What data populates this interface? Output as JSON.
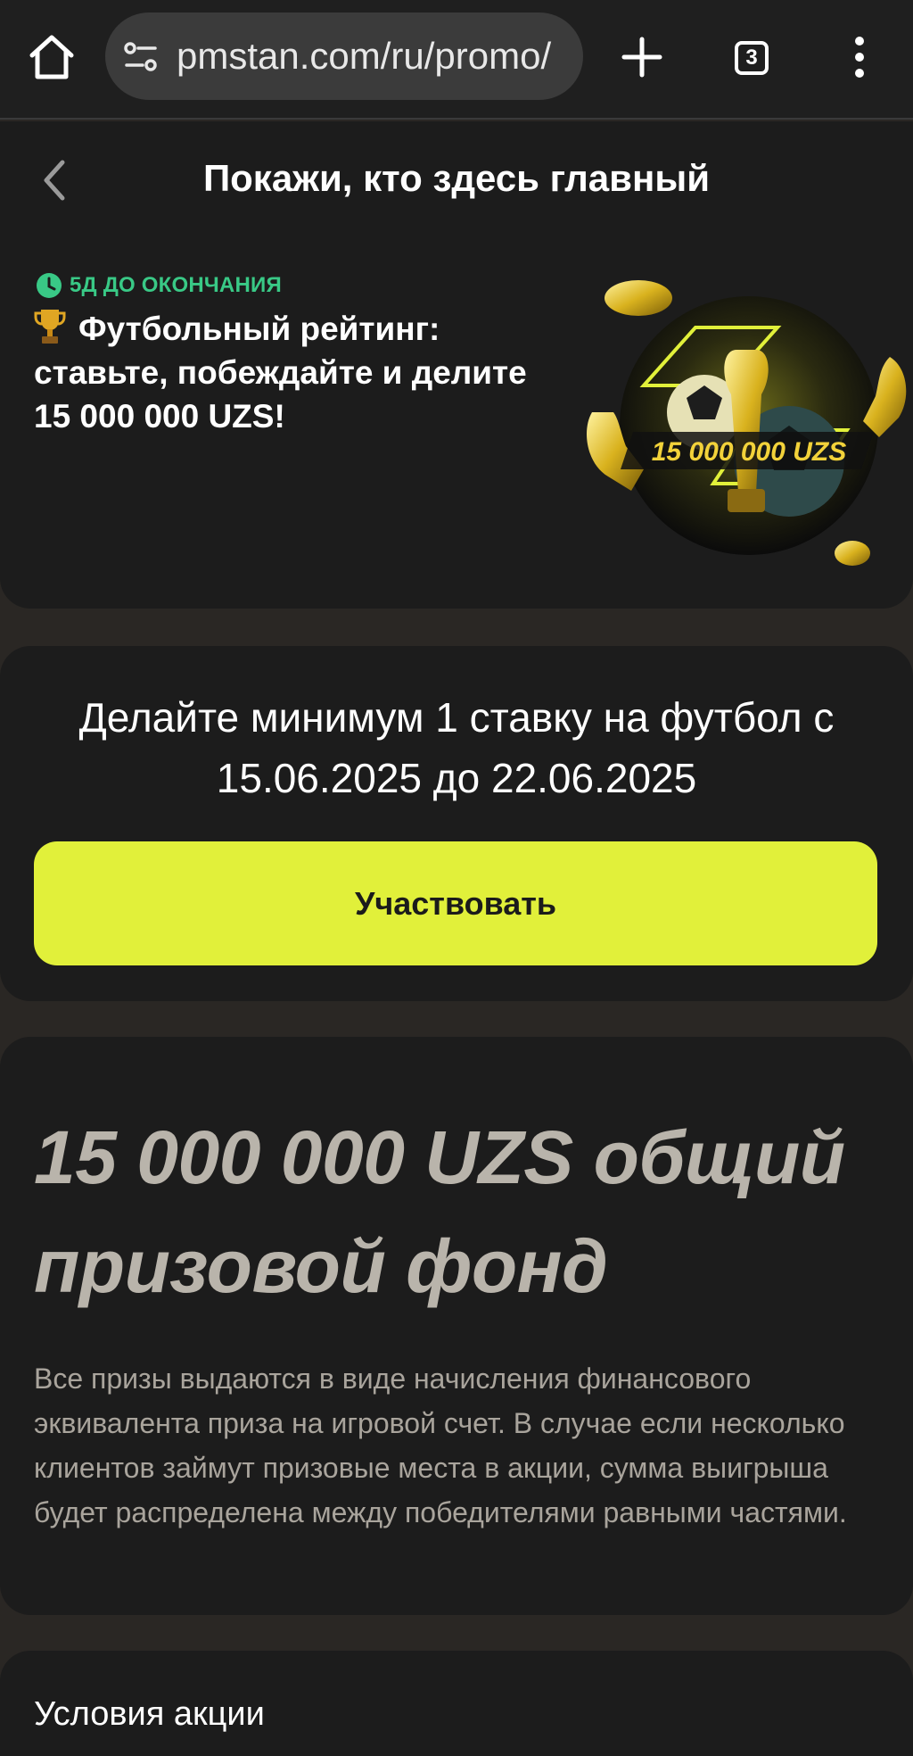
{
  "browser": {
    "url": "pmstan.com/ru/promo/",
    "tab_count": "3"
  },
  "header": {
    "title": "Покажи, кто здесь главный",
    "deadline": "5Д ДО ОКОНЧАНИЯ",
    "promo_heading": "Футбольный рейтинг: ставьте, побеждайте и делите 15 000 000 UZS!",
    "banner_amount": "15 000 000 UZS"
  },
  "join": {
    "description": "Делайте минимум 1 ставку на футбол с 15.06.2025 до 22.06.2025",
    "button_label": "Участвовать"
  },
  "prize": {
    "title": "15 000 000 UZS общий призовой фонд",
    "description": "Все призы выдаются в виде начисления финансового эквивалента приза на игровой счет. В случае если несколько клиентов займут призовые места в акции, сумма выигрыша будет распределена между победителями равными частями."
  },
  "terms": {
    "title": "Условия акции"
  },
  "colors": {
    "accent_yellow": "#e1f03a",
    "deadline_green": "#39c986",
    "card_bg": "#1c1c1c",
    "page_bg": "#2a2724"
  },
  "icons": [
    "home-icon",
    "site-settings-icon",
    "plus-icon",
    "tab-switcher-icon",
    "more-vert-icon",
    "back-chevron-icon",
    "clock-icon",
    "trophy-icon"
  ]
}
